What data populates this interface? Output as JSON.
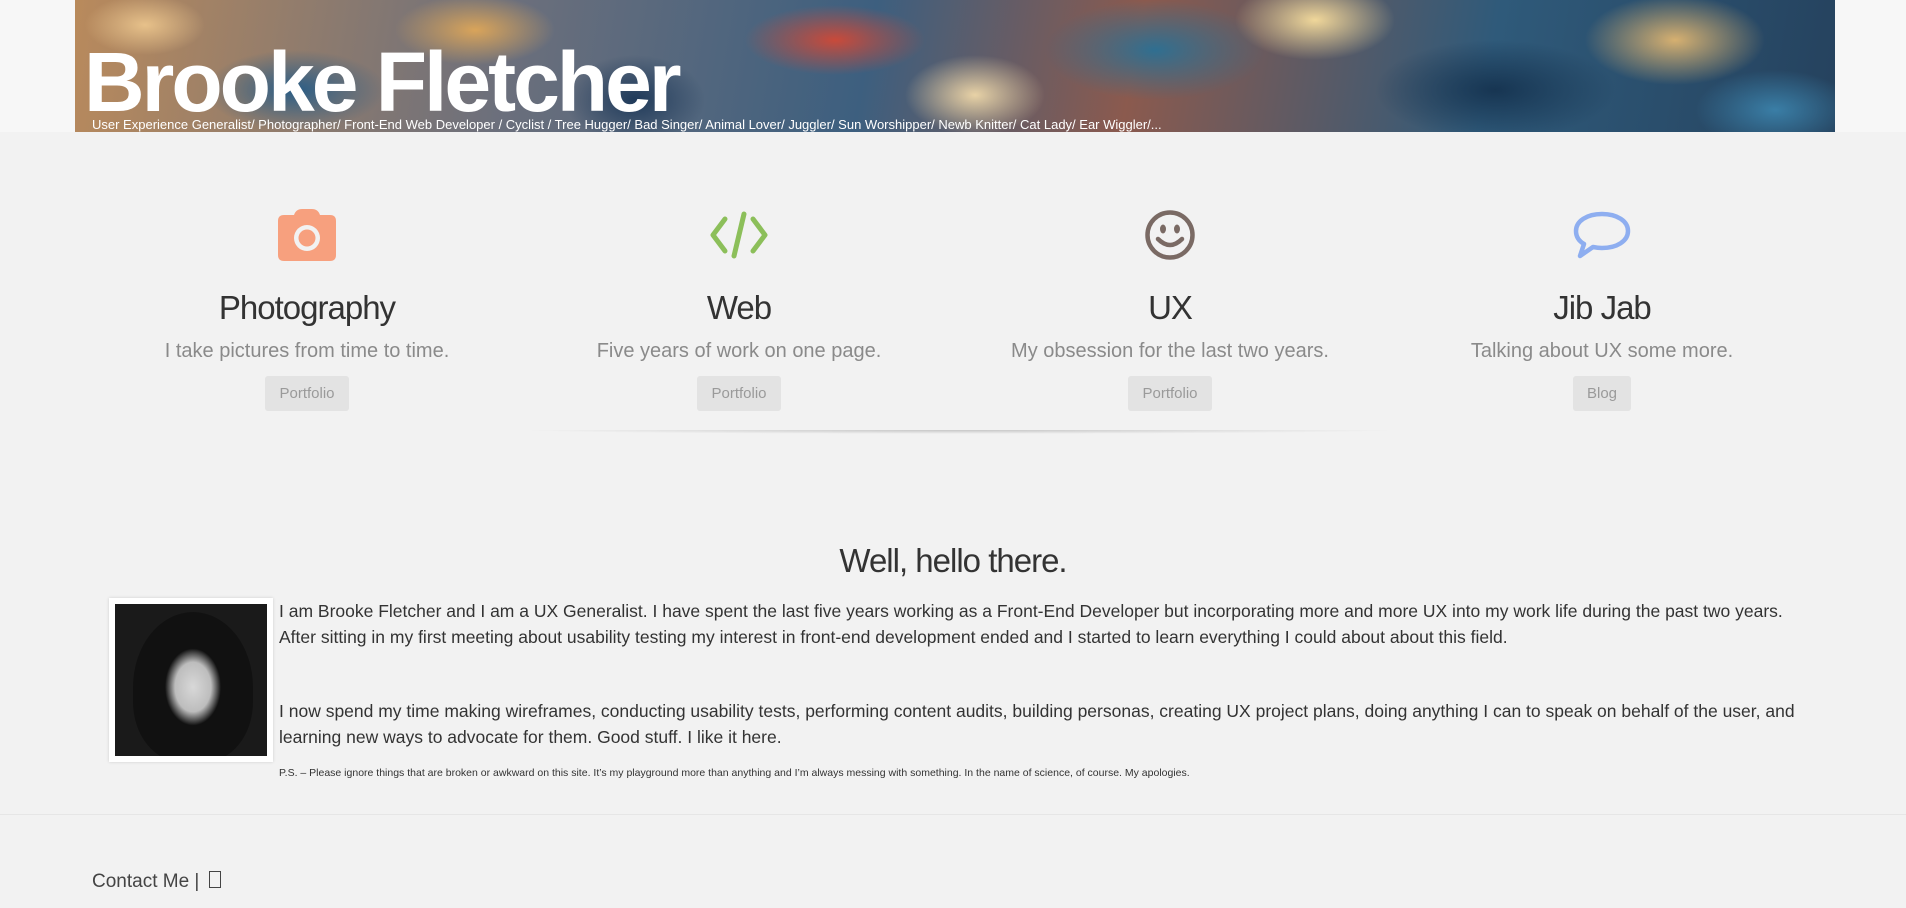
{
  "header": {
    "name": "Brooke Fletcher",
    "tagline": "User Experience Generalist/ Photographer/ Front-End Web Developer / Cyclist / Tree Hugger/ Bad Singer/ Animal Lover/ Juggler/ Sun Worshipper/ Newb Knitter/ Cat Lady/ Ear Wiggler/..."
  },
  "features": [
    {
      "icon": "camera-icon",
      "color": "#f7a07e",
      "title": "Photography",
      "desc": "I take pictures from time to time.",
      "button": "Portfolio"
    },
    {
      "icon": "code-icon",
      "color": "#8cbf5a",
      "title": "Web",
      "desc": "Five years of work on one page.",
      "button": "Portfolio"
    },
    {
      "icon": "smiley-icon",
      "color": "#7a6a64",
      "title": "UX",
      "desc": "My obsession for the last two years.",
      "button": "Portfolio"
    },
    {
      "icon": "speech-bubble-icon",
      "color": "#8eaef0",
      "title": "Jib Jab",
      "desc": "Talking about UX some more.",
      "button": "Blog"
    }
  ],
  "about": {
    "heading": "Well, hello there.",
    "p1": "I am Brooke Fletcher and I am a UX Generalist. I have spent the last five years working as a Front-End Developer but incorporating more and more UX into my work life during the past two years.  After sitting in my first meeting about usability testing my interest in front-end development ended and I started to learn everything I could about about this field.",
    "p2": "I now spend my time making wireframes, conducting usability tests, performing content audits, building personas, creating UX project plans, doing anything I can to speak on behalf of the user, and learning new ways to advocate for them.  Good stuff.  I like it here.",
    "ps": "P.S. – Please ignore things that are broken or awkward on this site.  It’s my playground more than anything and I’m always messing with something. In the name of science, of course.  My apologies."
  },
  "footer": {
    "contact": "Contact Me |"
  }
}
